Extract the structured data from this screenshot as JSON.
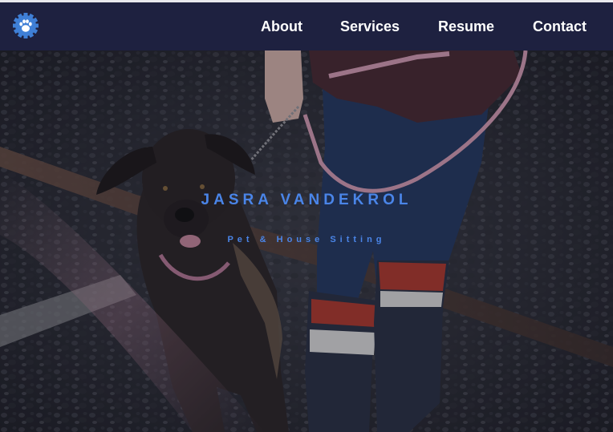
{
  "nav": {
    "logo_icon": "paw-icon",
    "items": [
      {
        "label": "About"
      },
      {
        "label": "Services"
      },
      {
        "label": "Resume"
      },
      {
        "label": "Contact"
      }
    ]
  },
  "hero": {
    "title": "JASRA VANDEKROL",
    "subtitle": "Pet & House Sitting",
    "image_description_icon": "dog-photo",
    "accent_color": "#4a85e8"
  },
  "colors": {
    "navbar": "#1e2140",
    "nav_text": "#ffffff"
  }
}
